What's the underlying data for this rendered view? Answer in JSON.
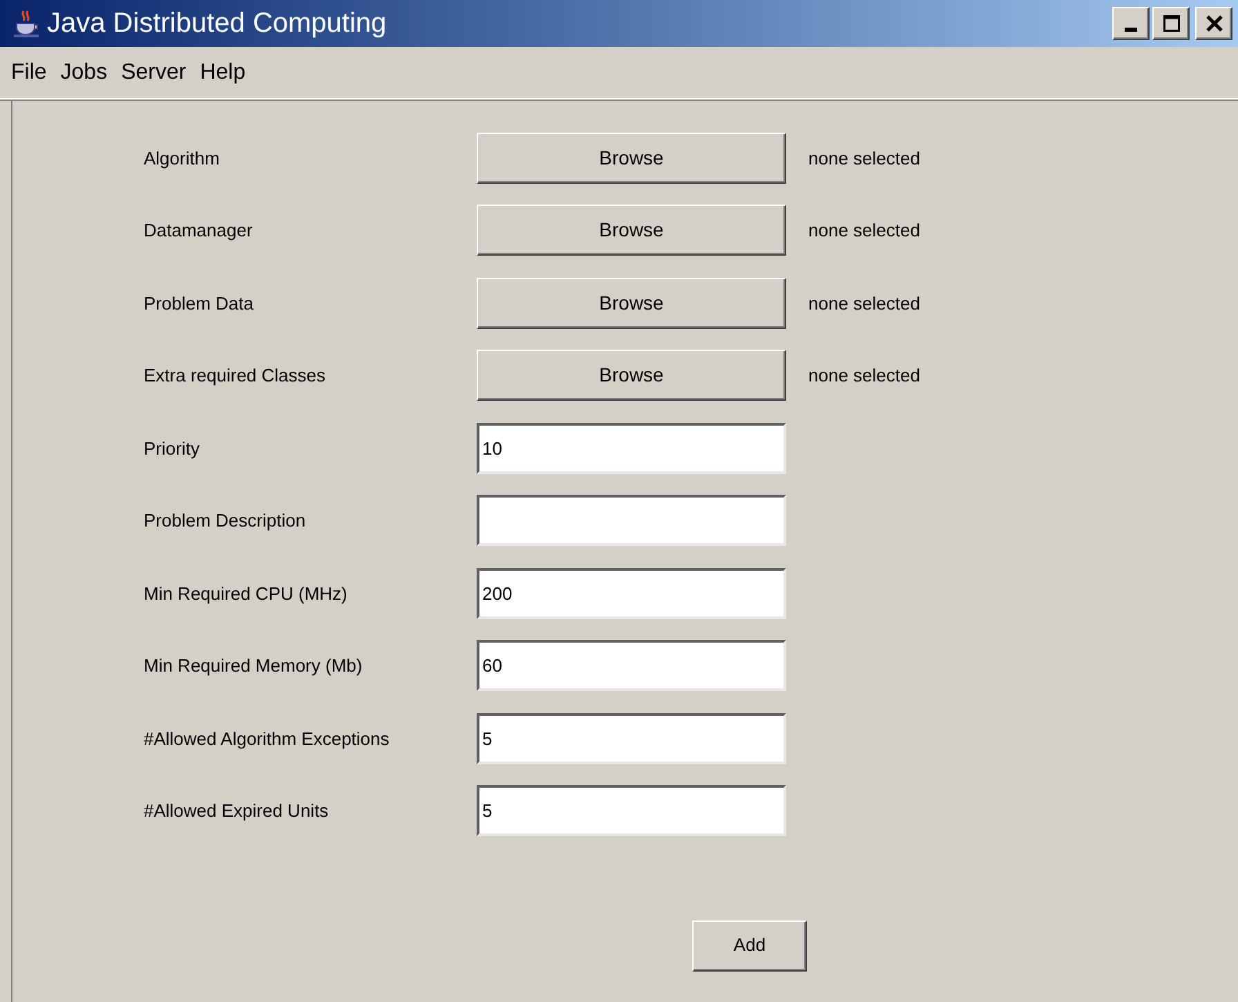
{
  "window": {
    "title": "Java Distributed Computing"
  },
  "menu": [
    "File",
    "Jobs",
    "Server",
    "Help"
  ],
  "rows": [
    {
      "kind": "browse",
      "label": "Algorithm",
      "button": "Browse",
      "status": "none selected"
    },
    {
      "kind": "browse",
      "label": "Datamanager",
      "button": "Browse",
      "status": "none selected"
    },
    {
      "kind": "browse",
      "label": "Problem Data",
      "button": "Browse",
      "status": "none selected"
    },
    {
      "kind": "browse",
      "label": "Extra required Classes",
      "button": "Browse",
      "status": "none selected"
    },
    {
      "kind": "field",
      "label": "Priority",
      "value": "10"
    },
    {
      "kind": "field",
      "label": "Problem Description"
    },
    {
      "kind": "field",
      "label": "Min Required CPU (MHz)",
      "value": "200"
    },
    {
      "kind": "field",
      "label": "Min Required Memory (Mb)",
      "value": "60"
    },
    {
      "kind": "field",
      "label": "#Allowed Algorithm Exceptions",
      "value": "5"
    },
    {
      "kind": "field",
      "label": "#Allowed Expired Units",
      "value": "5"
    }
  ],
  "add_button": "Add"
}
